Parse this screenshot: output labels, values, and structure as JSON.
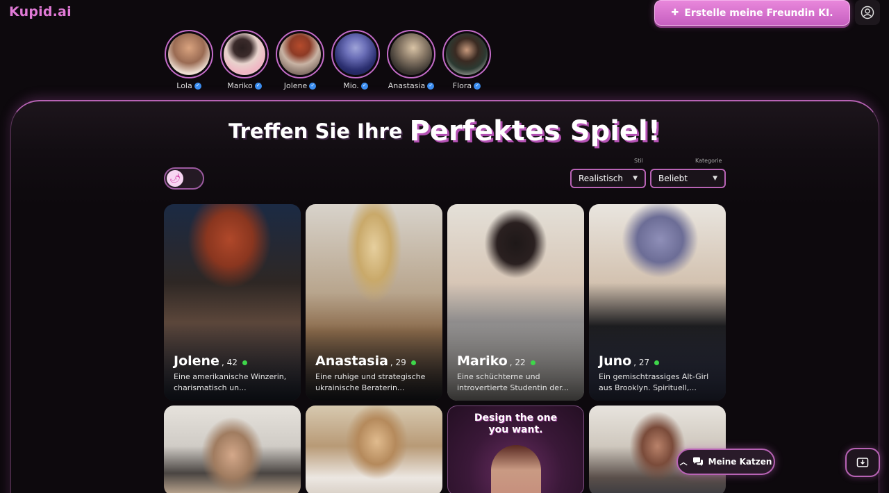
{
  "header": {
    "logo": "Kupid.ai",
    "create_button_label": "Erstelle meine Freundin KI.",
    "profile_icon": "user-circle-icon",
    "colors": {
      "brand": "#e07ad6",
      "accent_border": "#b863b5",
      "background": "#0d090d"
    }
  },
  "stories": [
    {
      "name": "Lola",
      "verified": true
    },
    {
      "name": "Mariko",
      "verified": true
    },
    {
      "name": "Jolene",
      "verified": true
    },
    {
      "name": "Mio.",
      "verified": true
    },
    {
      "name": "Anastasia",
      "verified": true
    },
    {
      "name": "Flora",
      "verified": true
    }
  ],
  "hero": {
    "title_part1": "Treffen Sie Ihre",
    "title_part2": "Perfektes Spiel!"
  },
  "filters": {
    "toggle_icon": "pepper-icon",
    "style_label": "Stil",
    "style_value": "Realistisch",
    "category_label": "Kategorie",
    "category_value": "Beliebt"
  },
  "cards": [
    {
      "name": "Jolene",
      "age": ", 42",
      "online": true,
      "description": "Eine amerikanische Winzerin, charismatisch un..."
    },
    {
      "name": "Anastasia",
      "age": ", 29",
      "online": true,
      "description": "Eine ruhige und strategische ukrainische Beraterin..."
    },
    {
      "name": "Mariko",
      "age": ", 22",
      "online": true,
      "description": "Eine schüchterne und introvertierte Studentin der..."
    },
    {
      "name": "Juno",
      "age": ", 27",
      "online": true,
      "description": "Ein gemischtrassiges Alt-Girl aus Brooklyn. Spirituell,..."
    }
  ],
  "promo_card": {
    "line1": "Design the one",
    "line2": "you want."
  },
  "floating": {
    "chats_label": "Meine Katzen",
    "chats_icon": "chat-bubbles-icon",
    "expand_icon": "chevron-up-icon",
    "install_icon": "download-icon"
  }
}
